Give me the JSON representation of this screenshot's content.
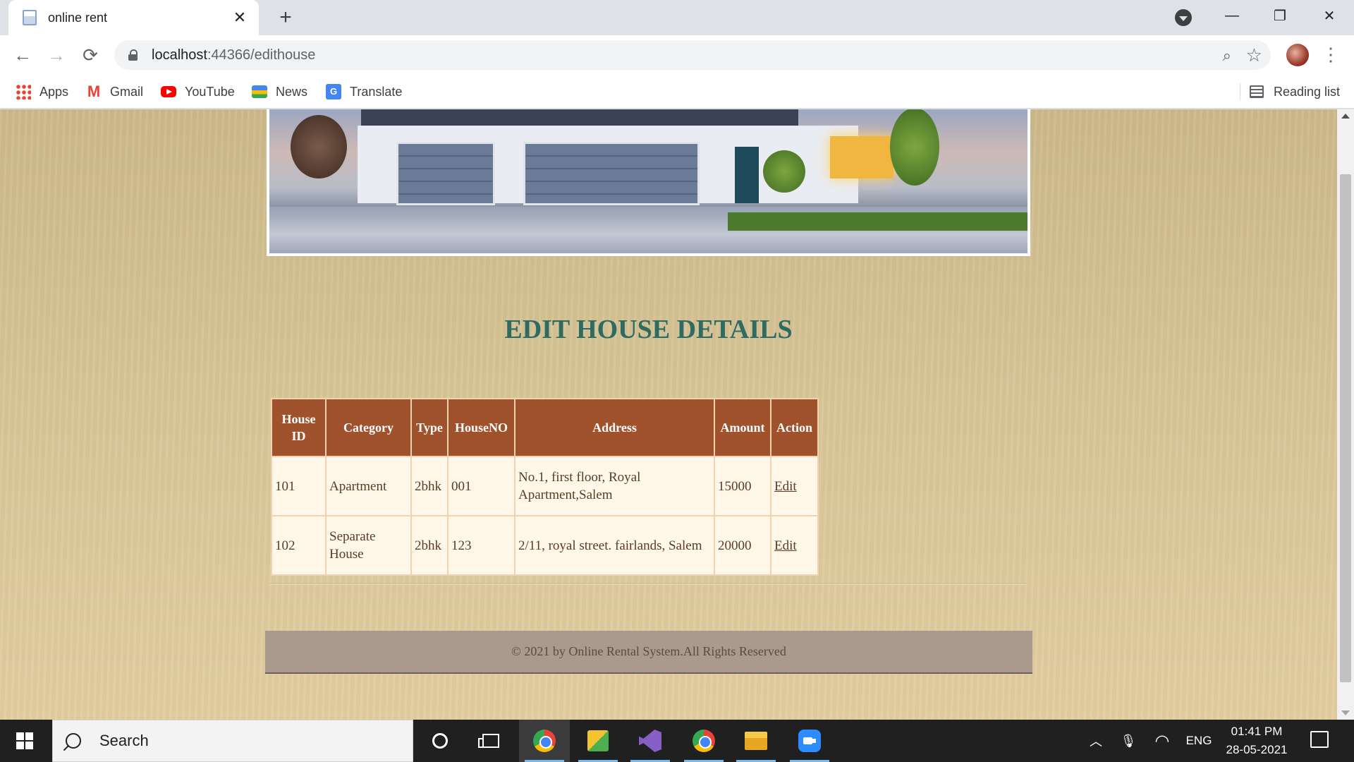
{
  "browser": {
    "tab_title": "online rent",
    "tab_close": "✕",
    "new_tab": "+",
    "url_host": "localhost",
    "url_path": ":44366/edithouse",
    "window_minimize": "—",
    "window_restore": "❐",
    "window_close": "✕",
    "back": "←",
    "forward": "→",
    "reload": "⟳",
    "zoom_glyph": "⌕",
    "star_glyph": "☆",
    "menu_glyph": "⋮"
  },
  "bookmarks": {
    "items": [
      {
        "label": "Apps",
        "icon": "apps-icon"
      },
      {
        "label": "Gmail",
        "icon": "gmail-icon"
      },
      {
        "label": "YouTube",
        "icon": "youtube-icon"
      },
      {
        "label": "News",
        "icon": "news-icon"
      },
      {
        "label": "Translate",
        "icon": "translate-icon"
      }
    ],
    "reading_list": "Reading list",
    "gmail_letter": "M",
    "translate_letter": "G"
  },
  "page": {
    "heading": "EDIT HOUSE DETAILS",
    "table": {
      "headers": {
        "house_id": "House ID",
        "category": "Category",
        "type": "Type",
        "house_no": "HouseNO",
        "address": "Address",
        "amount": "Amount",
        "action": "Action"
      },
      "rows": [
        {
          "house_id": "101",
          "category": "Apartment",
          "type": "2bhk",
          "house_no": "001",
          "address": "No.1, first floor, Royal Apartment,Salem",
          "amount": "15000",
          "action": "Edit"
        },
        {
          "house_id": "102",
          "category": "Separate House",
          "type": "2bhk",
          "house_no": "123",
          "address": "2/11, royal street. fairlands, Salem",
          "amount": "20000",
          "action": "Edit"
        }
      ]
    },
    "footer": "© 2021 by Online Rental System.All Rights Reserved"
  },
  "taskbar": {
    "search_label": "Search",
    "language": "ENG",
    "time": "01:41 PM",
    "date": "28-05-2021",
    "tray_chevron": "︿",
    "mic_glyph": "🎙",
    "wifi_glyph": "◠"
  },
  "colors": {
    "table_header": "#a0522d",
    "heading": "#2e6b62",
    "footer_bg": "#a99a8d",
    "page_bg": "#d7c597"
  }
}
